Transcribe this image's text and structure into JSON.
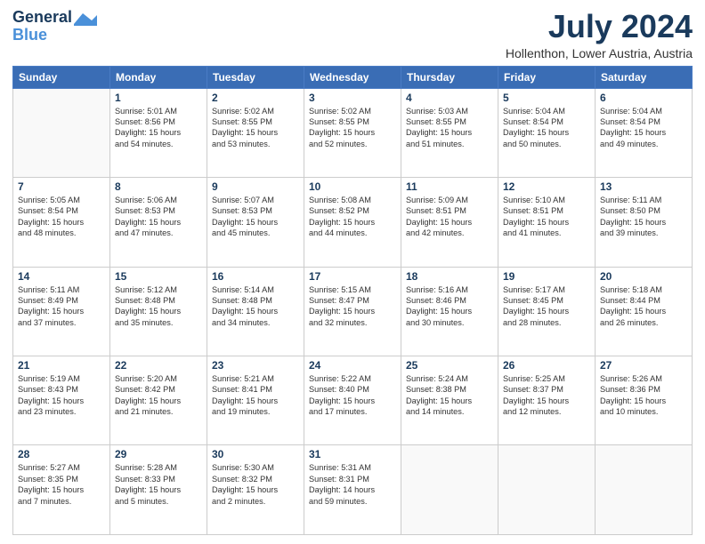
{
  "logo": {
    "line1": "General",
    "line2": "Blue",
    "icon_color": "#4a90d9"
  },
  "title": "July 2024",
  "location": "Hollenthon, Lower Austria, Austria",
  "days_of_week": [
    "Sunday",
    "Monday",
    "Tuesday",
    "Wednesday",
    "Thursday",
    "Friday",
    "Saturday"
  ],
  "weeks": [
    [
      {
        "day": "",
        "text": ""
      },
      {
        "day": "1",
        "text": "Sunrise: 5:01 AM\nSunset: 8:56 PM\nDaylight: 15 hours\nand 54 minutes."
      },
      {
        "day": "2",
        "text": "Sunrise: 5:02 AM\nSunset: 8:55 PM\nDaylight: 15 hours\nand 53 minutes."
      },
      {
        "day": "3",
        "text": "Sunrise: 5:02 AM\nSunset: 8:55 PM\nDaylight: 15 hours\nand 52 minutes."
      },
      {
        "day": "4",
        "text": "Sunrise: 5:03 AM\nSunset: 8:55 PM\nDaylight: 15 hours\nand 51 minutes."
      },
      {
        "day": "5",
        "text": "Sunrise: 5:04 AM\nSunset: 8:54 PM\nDaylight: 15 hours\nand 50 minutes."
      },
      {
        "day": "6",
        "text": "Sunrise: 5:04 AM\nSunset: 8:54 PM\nDaylight: 15 hours\nand 49 minutes."
      }
    ],
    [
      {
        "day": "7",
        "text": "Sunrise: 5:05 AM\nSunset: 8:54 PM\nDaylight: 15 hours\nand 48 minutes."
      },
      {
        "day": "8",
        "text": "Sunrise: 5:06 AM\nSunset: 8:53 PM\nDaylight: 15 hours\nand 47 minutes."
      },
      {
        "day": "9",
        "text": "Sunrise: 5:07 AM\nSunset: 8:53 PM\nDaylight: 15 hours\nand 45 minutes."
      },
      {
        "day": "10",
        "text": "Sunrise: 5:08 AM\nSunset: 8:52 PM\nDaylight: 15 hours\nand 44 minutes."
      },
      {
        "day": "11",
        "text": "Sunrise: 5:09 AM\nSunset: 8:51 PM\nDaylight: 15 hours\nand 42 minutes."
      },
      {
        "day": "12",
        "text": "Sunrise: 5:10 AM\nSunset: 8:51 PM\nDaylight: 15 hours\nand 41 minutes."
      },
      {
        "day": "13",
        "text": "Sunrise: 5:11 AM\nSunset: 8:50 PM\nDaylight: 15 hours\nand 39 minutes."
      }
    ],
    [
      {
        "day": "14",
        "text": "Sunrise: 5:11 AM\nSunset: 8:49 PM\nDaylight: 15 hours\nand 37 minutes."
      },
      {
        "day": "15",
        "text": "Sunrise: 5:12 AM\nSunset: 8:48 PM\nDaylight: 15 hours\nand 35 minutes."
      },
      {
        "day": "16",
        "text": "Sunrise: 5:14 AM\nSunset: 8:48 PM\nDaylight: 15 hours\nand 34 minutes."
      },
      {
        "day": "17",
        "text": "Sunrise: 5:15 AM\nSunset: 8:47 PM\nDaylight: 15 hours\nand 32 minutes."
      },
      {
        "day": "18",
        "text": "Sunrise: 5:16 AM\nSunset: 8:46 PM\nDaylight: 15 hours\nand 30 minutes."
      },
      {
        "day": "19",
        "text": "Sunrise: 5:17 AM\nSunset: 8:45 PM\nDaylight: 15 hours\nand 28 minutes."
      },
      {
        "day": "20",
        "text": "Sunrise: 5:18 AM\nSunset: 8:44 PM\nDaylight: 15 hours\nand 26 minutes."
      }
    ],
    [
      {
        "day": "21",
        "text": "Sunrise: 5:19 AM\nSunset: 8:43 PM\nDaylight: 15 hours\nand 23 minutes."
      },
      {
        "day": "22",
        "text": "Sunrise: 5:20 AM\nSunset: 8:42 PM\nDaylight: 15 hours\nand 21 minutes."
      },
      {
        "day": "23",
        "text": "Sunrise: 5:21 AM\nSunset: 8:41 PM\nDaylight: 15 hours\nand 19 minutes."
      },
      {
        "day": "24",
        "text": "Sunrise: 5:22 AM\nSunset: 8:40 PM\nDaylight: 15 hours\nand 17 minutes."
      },
      {
        "day": "25",
        "text": "Sunrise: 5:24 AM\nSunset: 8:38 PM\nDaylight: 15 hours\nand 14 minutes."
      },
      {
        "day": "26",
        "text": "Sunrise: 5:25 AM\nSunset: 8:37 PM\nDaylight: 15 hours\nand 12 minutes."
      },
      {
        "day": "27",
        "text": "Sunrise: 5:26 AM\nSunset: 8:36 PM\nDaylight: 15 hours\nand 10 minutes."
      }
    ],
    [
      {
        "day": "28",
        "text": "Sunrise: 5:27 AM\nSunset: 8:35 PM\nDaylight: 15 hours\nand 7 minutes."
      },
      {
        "day": "29",
        "text": "Sunrise: 5:28 AM\nSunset: 8:33 PM\nDaylight: 15 hours\nand 5 minutes."
      },
      {
        "day": "30",
        "text": "Sunrise: 5:30 AM\nSunset: 8:32 PM\nDaylight: 15 hours\nand 2 minutes."
      },
      {
        "day": "31",
        "text": "Sunrise: 5:31 AM\nSunset: 8:31 PM\nDaylight: 14 hours\nand 59 minutes."
      },
      {
        "day": "",
        "text": ""
      },
      {
        "day": "",
        "text": ""
      },
      {
        "day": "",
        "text": ""
      }
    ]
  ]
}
